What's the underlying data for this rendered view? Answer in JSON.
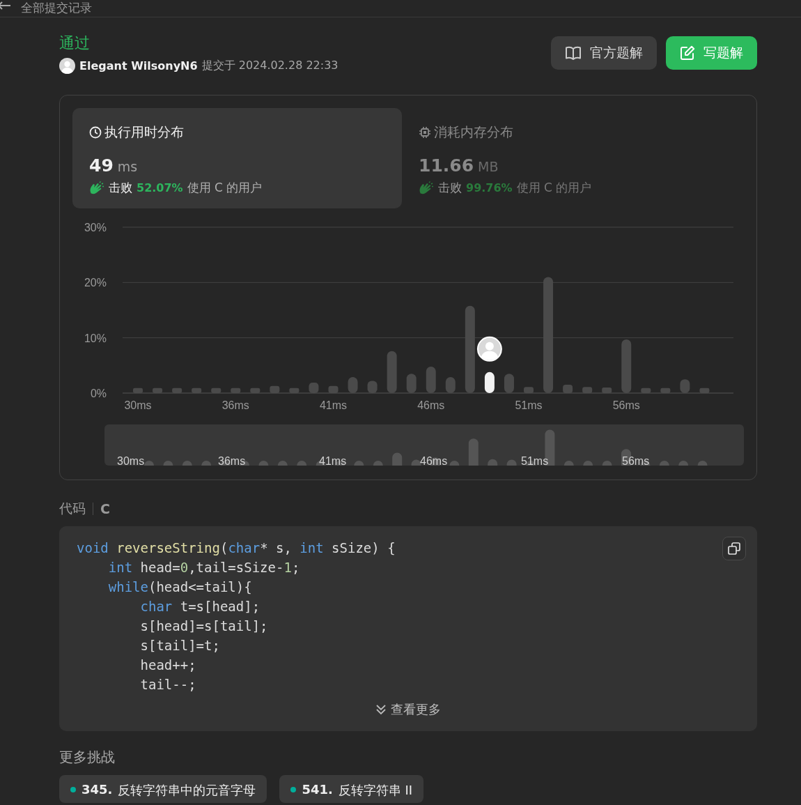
{
  "back_label": "全部提交记录",
  "submission": {
    "status": "通过",
    "user": "Elegant WilsonyN6",
    "submitted_label": "提交于",
    "time": "2024.02.28 22:33"
  },
  "actions": [
    {
      "kind": "solutions",
      "label": "官方题解"
    },
    {
      "kind": "write",
      "label": "写题解"
    }
  ],
  "stats": [
    {
      "kind": "runtime",
      "selected": true,
      "title": "执行用时分布",
      "value": "49",
      "unit": "ms",
      "beat_label": "击败",
      "percent": "52.07%",
      "suffix": "使用 C 的用户"
    },
    {
      "kind": "memory",
      "selected": false,
      "title": "消耗内存分布",
      "value": "11.66",
      "unit": "MB",
      "beat_label": "击败",
      "percent": "99.76%",
      "suffix": "使用 C 的用户"
    }
  ],
  "runtime_chart": {
    "chart_data": {
      "type": "bar",
      "stacked": true,
      "ylim": [
        0,
        30
      ],
      "categories": [
        "30ms",
        null,
        null,
        null,
        null,
        "36ms",
        null,
        null,
        null,
        null,
        "41ms",
        null,
        null,
        null,
        null,
        "46ms",
        null,
        null,
        null,
        null,
        "51ms",
        null,
        null,
        null,
        null,
        "56ms",
        null,
        null,
        null,
        null
      ],
      "series": [
        {
          "color": "#4a4a4a",
          "values": [
            0.9,
            0.9,
            0.9,
            0.9,
            0.9,
            0.9,
            0.9,
            1.3,
            0.9,
            1.9,
            1.3,
            2.9,
            2.2,
            7.6,
            3.5,
            4.8,
            2.9,
            15.8,
            null,
            3.5,
            1.1,
            21,
            1.5,
            1.1,
            1.0,
            9.7,
            0.9,
            0.9,
            2.5,
            0.9
          ]
        },
        {
          "color": "#f2f2f2",
          "values": [
            null,
            null,
            null,
            null,
            null,
            null,
            null,
            null,
            null,
            null,
            null,
            null,
            null,
            null,
            null,
            null,
            null,
            null,
            3.8,
            null,
            null,
            null,
            null,
            null,
            null,
            null,
            null,
            null,
            null,
            null
          ]
        }
      ],
      "yticks": [
        {
          "value": 0,
          "label": "0%"
        },
        {
          "value": 10,
          "label": "10%"
        },
        {
          "value": 20,
          "label": "20%"
        },
        {
          "value": 30,
          "label": "30%"
        }
      ]
    },
    "overview_labels": [
      "30ms",
      "36ms",
      "41ms",
      "46ms",
      "51ms",
      "56ms"
    ]
  },
  "code": {
    "label": "代码",
    "language": "C",
    "more": "查看更多",
    "lines": [
      [
        {
          "kind": "keyword",
          "text": "void"
        },
        {
          "kind": "function",
          "text": " reverseString"
        },
        {
          "kind": "plain",
          "text": "("
        },
        {
          "kind": "keyword",
          "text": "char"
        },
        {
          "kind": "plain",
          "text": "* s, "
        },
        {
          "kind": "keyword",
          "text": "int"
        },
        {
          "kind": "plain",
          "text": " sSize) {"
        }
      ],
      [
        {
          "kind": "keyword",
          "text": "    int"
        },
        {
          "kind": "plain",
          "text": " head="
        },
        {
          "kind": "number",
          "text": "0"
        },
        {
          "kind": "plain",
          "text": ",tail=sSize-"
        },
        {
          "kind": "number",
          "text": "1"
        },
        {
          "kind": "plain",
          "text": ";"
        }
      ],
      [
        {
          "kind": "keyword",
          "text": "    while"
        },
        {
          "kind": "plain",
          "text": "(head<=tail){"
        }
      ],
      [
        {
          "kind": "keyword",
          "text": "        char"
        },
        {
          "kind": "plain",
          "text": " t=s[head];"
        }
      ],
      [
        {
          "kind": "plain",
          "text": "        s[head]=s[tail];"
        }
      ],
      [
        {
          "kind": "plain",
          "text": "        s[tail]=t;"
        }
      ],
      [
        {
          "kind": "plain",
          "text": "        head++;"
        }
      ],
      [
        {
          "kind": "plain",
          "text": "        tail--;"
        }
      ]
    ]
  },
  "more_challenges": {
    "title": "更多挑战",
    "items": [
      {
        "number": "345.",
        "title": "反转字符串中的元音字母",
        "color": "#00af9b"
      },
      {
        "number": "541.",
        "title": "反转字符串 II",
        "color": "#00af9b"
      }
    ]
  }
}
